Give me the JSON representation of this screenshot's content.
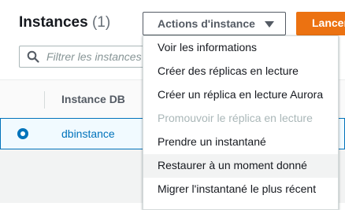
{
  "header": {
    "title": "Instances",
    "count": "(1)",
    "actions_label": "Actions d'instance",
    "launch_label": "Lancer"
  },
  "search": {
    "placeholder": "Filtrer les instances"
  },
  "table": {
    "columns": [
      "Instance DB"
    ],
    "rows": [
      {
        "name": "dbinstance",
        "selected": true
      }
    ]
  },
  "menu": {
    "items": [
      {
        "label": "Voir les informations",
        "disabled": false
      },
      {
        "label": "Créer des réplicas en lecture",
        "disabled": false
      },
      {
        "label": "Créer un réplica en lecture Aurora",
        "disabled": false
      },
      {
        "label": "Promouvoir le réplica en lecture",
        "disabled": true
      },
      {
        "label": "Prendre un instantané",
        "disabled": false
      },
      {
        "label": "Restaurer à un moment donné",
        "disabled": false,
        "highlighted": true
      },
      {
        "label": "Migrer l'instantané le plus récent",
        "disabled": false
      }
    ]
  },
  "colors": {
    "accent": "#0073bb",
    "launch": "#ec7211"
  },
  "icons": [
    "search-icon",
    "chevron-down-icon",
    "radio-selected-icon"
  ]
}
